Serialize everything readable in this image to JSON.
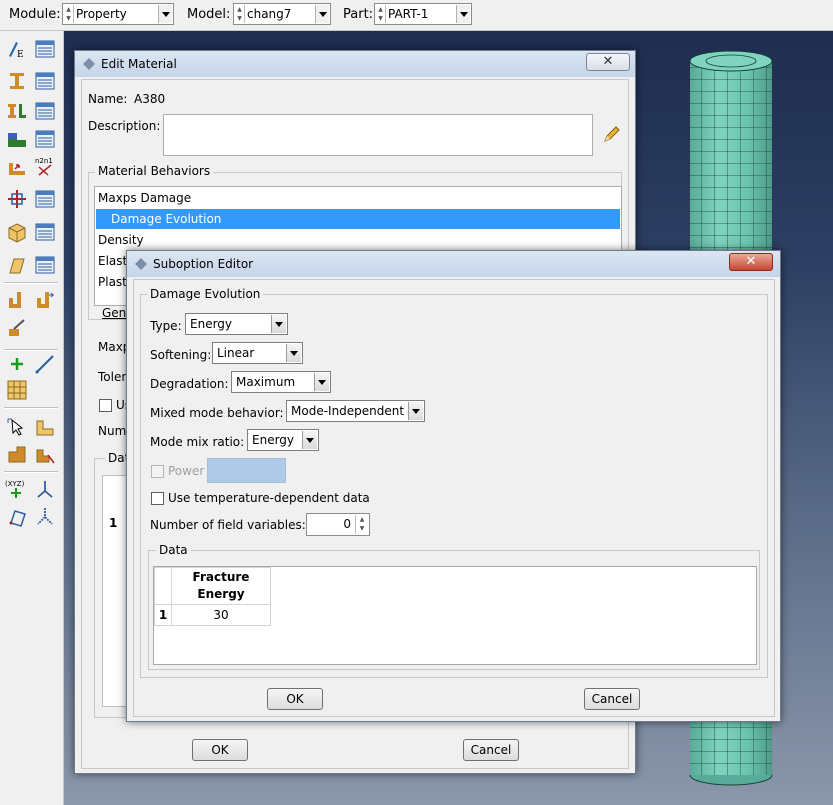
{
  "topbar": {
    "module_label": "Module:",
    "module_value": "Property",
    "model_label": "Model:",
    "model_value": "chang7",
    "part_label": "Part:",
    "part_value": "PART-1"
  },
  "toolbox": {
    "icons": [
      "material-manager-icon",
      "section-manager-icon",
      "profile-icon",
      "assign-section-icon",
      "orientation-icon",
      "composite-layup-icon",
      "skin-icon",
      "stringer-icon",
      "special-icon",
      "datum-point-icon",
      "datum-axis-icon",
      "datum-plane-icon",
      "datum-csys-icon",
      "partition-icon",
      "create-set-icon",
      "inertia-icon",
      "query-icon"
    ]
  },
  "edit_material": {
    "title": "Edit Material",
    "close_label": "✕",
    "name_label": "Name:",
    "name_value": "A380",
    "description_label": "Description:",
    "description_value": "",
    "behaviors_label": "Material Behaviors",
    "behaviors": [
      "Maxps Damage",
      "Damage Evolution",
      "Density",
      "Elastic",
      "Plastic"
    ],
    "behaviors_visible": [
      "Maxps Damage",
      "Damage Evolution",
      "Density",
      "Elasti",
      "Plasti"
    ],
    "selected_behavior": "Damage Evolution",
    "general_tab_partial": "Gen",
    "section_partial": "Maxp",
    "tolerance_partial": "Toler",
    "use_partial": "Us",
    "number_partial": "Num",
    "data_partial": "Dat",
    "row_number": "1",
    "ok_label": "OK",
    "cancel_label": "Cancel"
  },
  "suboption_editor": {
    "title": "Suboption Editor",
    "close_label": "✕",
    "group_label": "Damage Evolution",
    "type_label": "Type:",
    "type_value": "Energy",
    "softening_label": "Softening:",
    "softening_value": "Linear",
    "degradation_label": "Degradation:",
    "degradation_value": "Maximum",
    "mixed_mode_label": "Mixed mode behavior:",
    "mixed_mode_value": "Mode-Independent",
    "mode_mix_label": "Mode mix ratio:",
    "mode_mix_value": "Energy",
    "power_label": "Power",
    "power_value": "",
    "power_checked": false,
    "power_enabled": false,
    "temp_dependent_label": "Use temperature-dependent data",
    "temp_dependent_checked": false,
    "field_vars_label": "Number of field variables:",
    "field_vars_value": "0",
    "data_group_label": "Data",
    "table": {
      "headers": [
        "Fracture Energy"
      ],
      "header_line1": "Fracture",
      "header_line2": "Energy",
      "rows": [
        {
          "index": "1",
          "values": [
            "30"
          ]
        }
      ]
    },
    "ok_label": "OK",
    "cancel_label": "Cancel"
  },
  "colors": {
    "selection": "#3399ff",
    "mesh": "#6cc5b0",
    "viewport_top": "#1e2d50",
    "viewport_bottom": "#8b97aa"
  }
}
